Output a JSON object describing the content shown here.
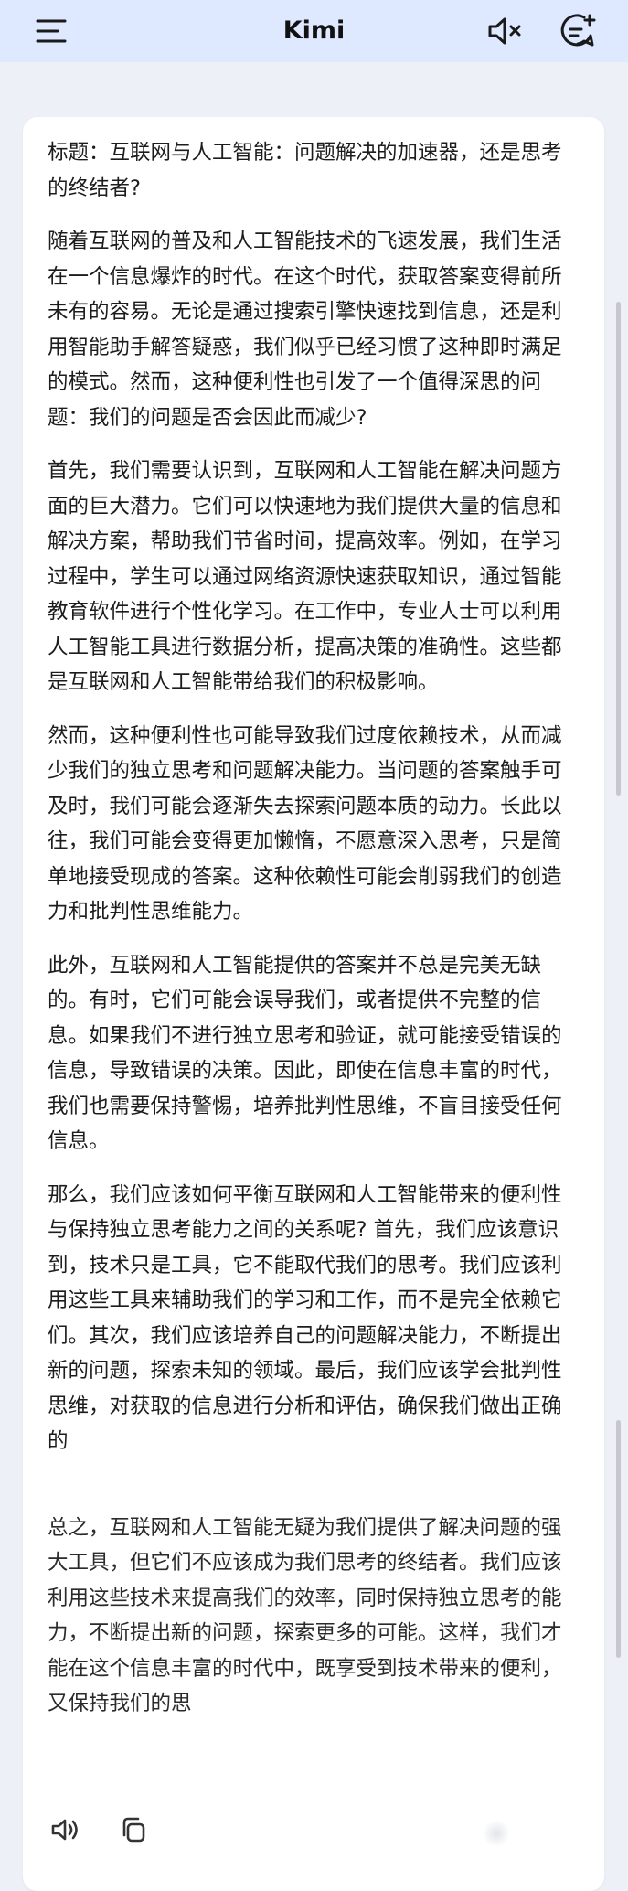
{
  "header": {
    "title": "Kimi",
    "background_color": "#dee8fe",
    "icons": [
      "menu-icon",
      "speaker-muted-icon",
      "new-chat-icon"
    ]
  },
  "message": {
    "paragraphs": [
      "标题：互联网与人工智能：问题解决的加速器，还是思考的终结者?",
      "随着互联网的普及和人工智能技术的飞速发展，我们生活在一个信息爆炸的时代。在这个时代，获取答案变得前所未有的容易。无论是通过搜索引擎快速找到信息，还是利用智能助手解答疑惑，我们似乎已经习惯了这种即时满足的模式。然而，这种便利性也引发了一个值得深思的问题：我们的问题是否会因此而减少?",
      "首先，我们需要认识到，互联网和人工智能在解决问题方面的巨大潜力。它们可以快速地为我们提供大量的信息和解决方案，帮助我们节省时间，提高效率。例如，在学习过程中，学生可以通过网络资源快速获取知识，通过智能教育软件进行个性化学习。在工作中，专业人士可以利用人工智能工具进行数据分析，提高决策的准确性。这些都是互联网和人工智能带给我们的积极影响。",
      "然而，这种便利性也可能导致我们过度依赖技术，从而减少我们的独立思考和问题解决能力。当问题的答案触手可及时，我们可能会逐渐失去探索问题本质的动力。长此以往，我们可能会变得更加懒惰，不愿意深入思考，只是简单地接受现成的答案。这种依赖性可能会削弱我们的创造力和批判性思维能力。",
      "此外，互联网和人工智能提供的答案并不总是完美无缺的。有时，它们可能会误导我们，或者提供不完整的信息。如果我们不进行独立思考和验证，就可能接受错误的信息，导致错误的决策。因此，即使在信息丰富的时代，我们也需要保持警惕，培养批判性思维，不盲目接受任何信息。",
      "那么，我们应该如何平衡互联网和人工智能带来的便利性与保持独立思考能力之间的关系呢? 首先，我们应该意识到，技术只是工具，它不能取代我们的思考。我们应该利用这些工具来辅助我们的学习和工作，而不是完全依赖它们。其次，我们应该培养自己的问题解决能力，不断提出新的问题，探索未知的领域。最后，我们应该学会批判性思维，对获取的信息进行分析和评估，确保我们做出正确的",
      "总之，互联网和人工智能无疑为我们提供了解决问题的强大工具，但它们不应该成为我们思考的终结者。我们应该利用这些技术来提高我们的效率，同时保持独立思考的能力，不断提出新的问题，探索更多的可能。这样，我们才能在这个信息丰富的时代中，既享受到技术带来的便利，又保持我们的思"
    ]
  },
  "actions": {
    "icons": [
      "speaker-icon",
      "copy-icon"
    ]
  },
  "colors": {
    "page_background": "#eef0f7",
    "card_background": "#ffffff",
    "text": "#1c1c1c"
  }
}
